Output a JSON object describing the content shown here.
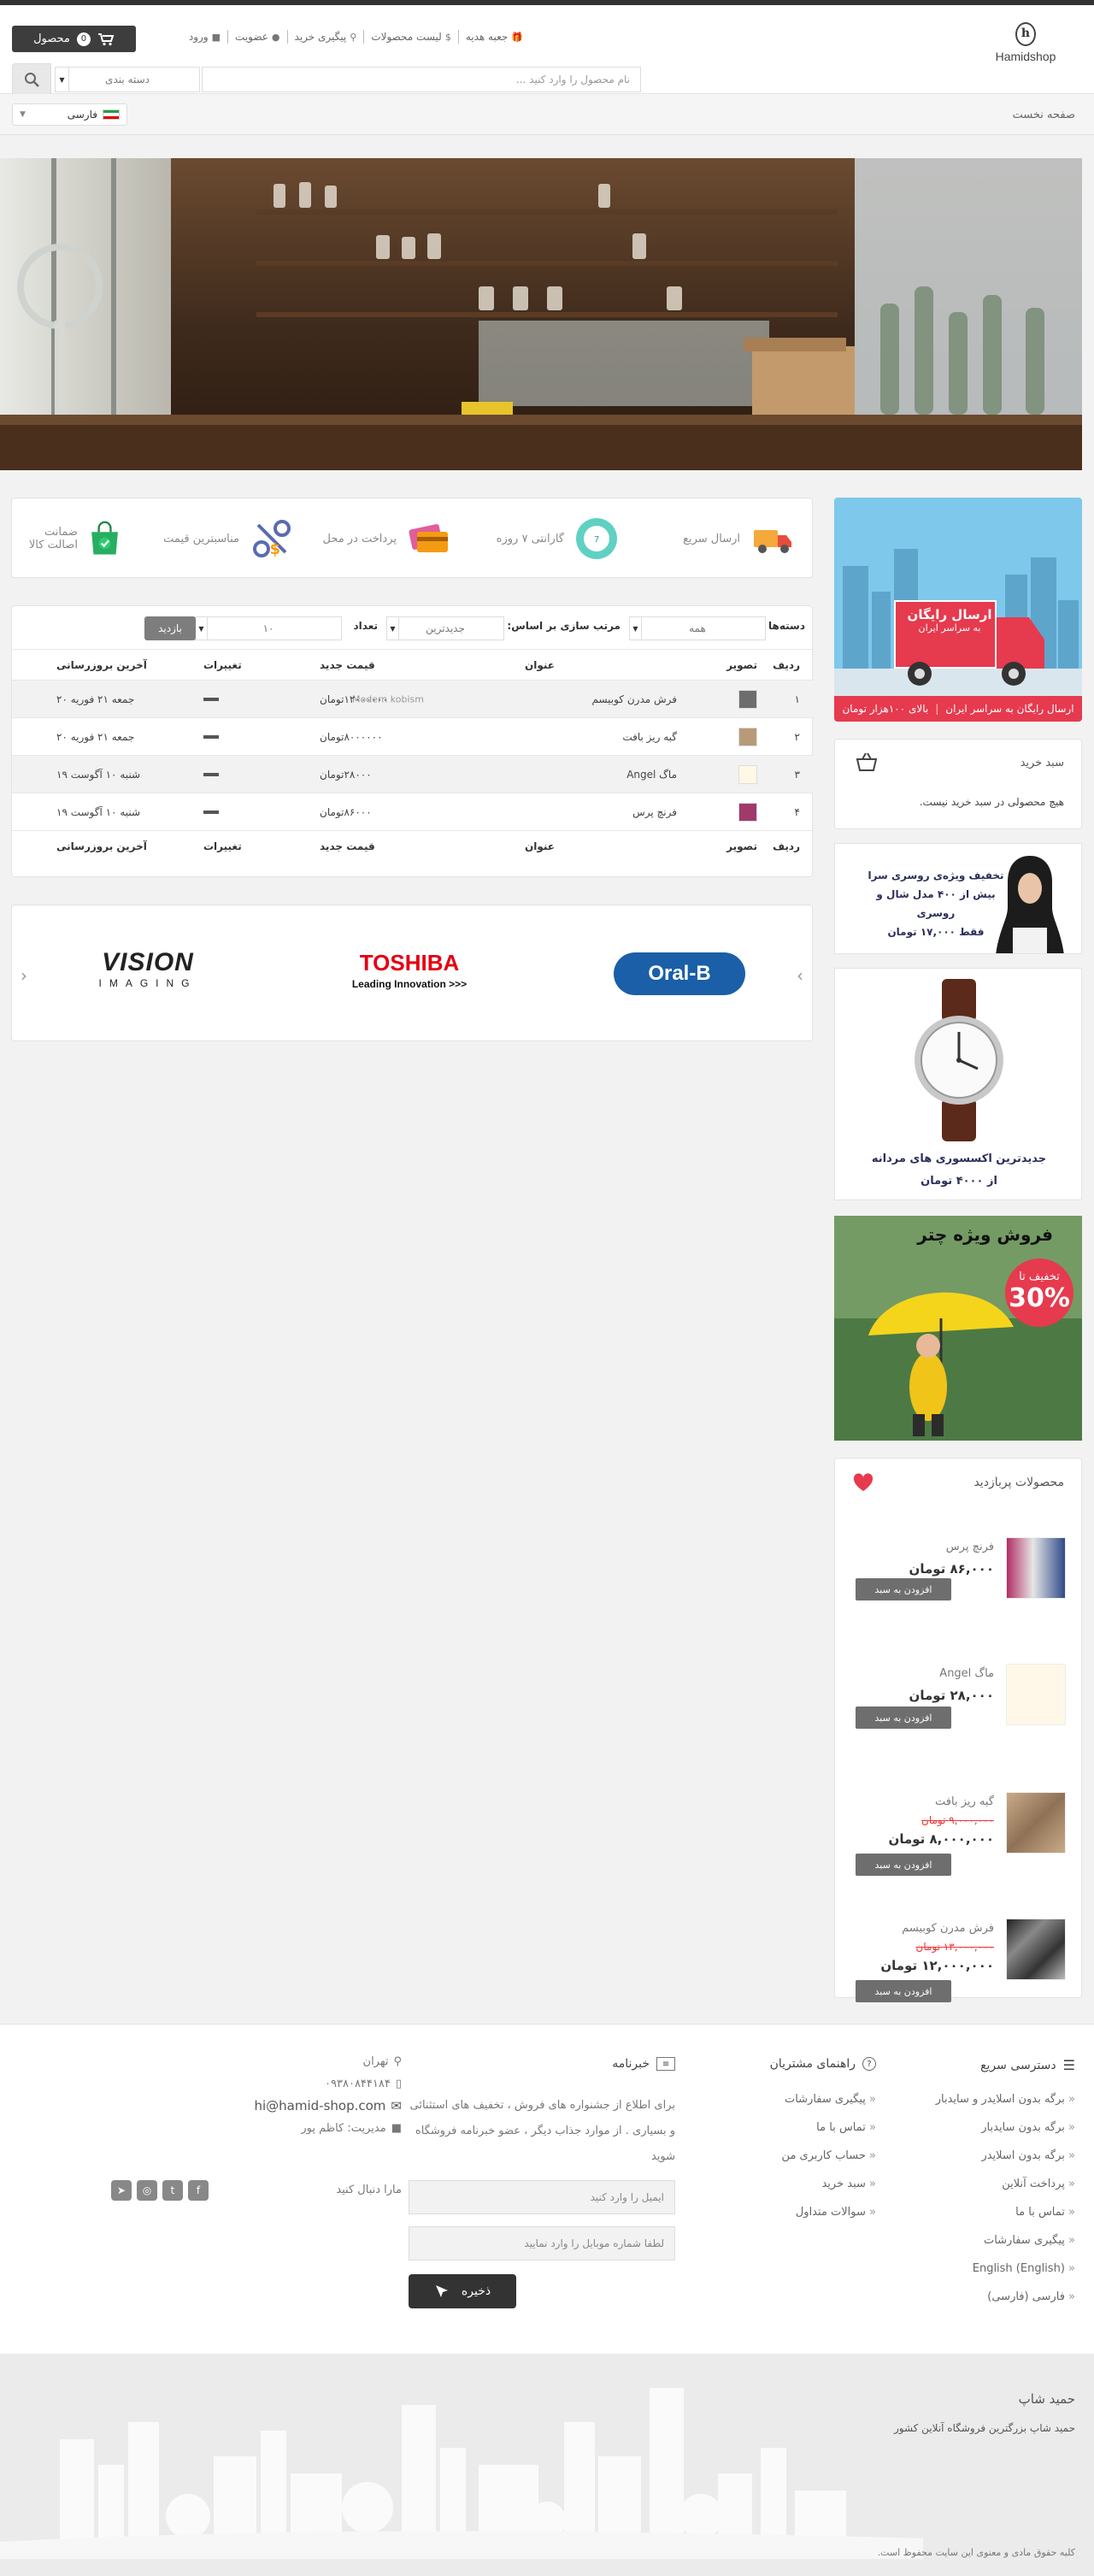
{
  "header": {
    "logo_text": "Hamidshop",
    "logo_mark": "h",
    "links": [
      {
        "label": "جعبه هدیه",
        "icon": "gift-icon",
        "glyph": "🎁"
      },
      {
        "label": "لیست محصولات",
        "icon": "dollar-icon",
        "glyph": "$"
      },
      {
        "label": "پیگیری خرید",
        "icon": "map-marker-icon",
        "glyph": "⚲"
      },
      {
        "label": "عضویت",
        "icon": "user-icon",
        "glyph": "●"
      },
      {
        "label": "ورود",
        "icon": "lock-icon",
        "glyph": "■"
      }
    ],
    "cart_label": "محصول",
    "cart_count": "0",
    "search_placeholder": "نام محصول را وارد کنید ...",
    "category_label": "دسته بندی"
  },
  "breadcrumb": {
    "home": "صفحه نخست"
  },
  "language": {
    "selected": "فارسی"
  },
  "features": [
    {
      "label": "ارسال سریع",
      "icon": "truck-icon"
    },
    {
      "label": "گارانتی ۷ روزه",
      "icon": "guarantee-badge-icon"
    },
    {
      "label": "پرداخت در محل",
      "icon": "credit-card-icon"
    },
    {
      "label": "مناسبترین قیمت",
      "icon": "price-tag-icon"
    },
    {
      "label": "ضمانت اصالت کالا",
      "icon": "shopping-bag-check-icon"
    }
  ],
  "filters": {
    "category_label": "دسته‌ها",
    "category_value": "همه",
    "sort_label": "مرتب سازی بر اساس:",
    "sort_value": "جدیدترین",
    "count_label": "تعداد",
    "count_value": "۱۰",
    "visit_button": "بازدید"
  },
  "table": {
    "columns": [
      "ردیف",
      "تصویر",
      "عنوان",
      "قیمت جدید",
      "تغییرات",
      "آخرین بروزرسانی"
    ],
    "rows": [
      {
        "idx": "۱",
        "title": "فرش مدرن کوبیسم",
        "sub": "Modern kobism",
        "price": "۱۲۰۰۰۰۰۰تومان",
        "date": "جمعه ۲۱ فوریه ۲۰"
      },
      {
        "idx": "۲",
        "title": "گبه ریز بافت",
        "sub": "",
        "price": "۸۰۰۰۰۰۰تومان",
        "date": "جمعه ۲۱ فوریه ۲۰"
      },
      {
        "idx": "۳",
        "title": "ماگ Angel",
        "sub": "",
        "price": "۲۸۰۰۰تومان",
        "date": "شنبه ۱۰ آگوست ۱۹"
      },
      {
        "idx": "۴",
        "title": "فرنچ پرس",
        "sub": "",
        "price": "۸۶۰۰۰تومان",
        "date": "شنبه ۱۰ آگوست ۱۹"
      }
    ]
  },
  "brands": [
    "Oral-B",
    "TOSHIBA",
    "Leading Innovation >>>",
    "VISION",
    "IMAGING"
  ],
  "sidebar": {
    "freeship_title": "ارسال رایگان",
    "freeship_sub": "به سراسر ایران",
    "freeship_bar": [
      "ارسال رایگان به سراسر ایران",
      "بالای ۱۰۰هزار تومان"
    ],
    "cart_title": "سبد خرید",
    "cart_empty": "هیچ محصولی در سبد خرید نیست.",
    "scarf_lines": [
      "تخفیف ویژه‌ی روسری سرا",
      "بیش از ۴۰۰ مدل شال و روسری",
      "فقط ۱۷,۰۰۰ تومان"
    ],
    "watch_lines": [
      "جدیدترین اکسسوری های مردانه",
      "از ۴۰۰۰ تومان"
    ],
    "umbrella_title": "فروش ویژه چتر",
    "umbrella_badge_top": "تخفیف تا",
    "umbrella_badge_pct": "30%",
    "bestsellers_title": "محصولات پربازدید",
    "bestsellers": [
      {
        "name": "فرنچ پرس",
        "old": "",
        "price": "۸۶,۰۰۰ تومان",
        "button": "افزودن به سبد"
      },
      {
        "name": "ماگ Angel",
        "old": "",
        "price": "۲۸,۰۰۰ تومان",
        "button": "افزودن به سبد"
      },
      {
        "name": "گبه ریز بافت",
        "old": "۹,۰۰۰,۰۰۰ تومان",
        "price": "۸,۰۰۰,۰۰۰ تومان",
        "button": "افزودن به سبد"
      },
      {
        "name": "فرش مدرن کوبیسم",
        "old": "۱۳,۰۰۰,۰۰۰ تومان",
        "price": "۱۲,۰۰۰,۰۰۰ تومان",
        "button": "افزودن به سبد"
      }
    ]
  },
  "footer": {
    "quick_title": "دسترسی سریع",
    "quick_links": [
      "برگه بدون اسلایدر و سایدبار",
      "برگه بدون سایدبار",
      "برگه بدون اسلایدر",
      "پرداخت آنلاین",
      "تماس با ما",
      "پیگیری سفارشات",
      "English (English)",
      "فارسی (فارسی)"
    ],
    "help_title": "راهنمای مشتریان",
    "help_links": [
      "پیگیری سفارشات",
      "تماس با ما",
      "حساب کاربری من",
      "سبد خرید",
      "سوالات متداول"
    ],
    "newsletter_title": "خبرنامه",
    "newsletter_text": "برای اطلاع از جشنواره های فروش ، تخفیف های استثنائی و بسیاری . از موارد جذاب دیگر ، عضو خبرنامه فروشگاه شوید",
    "email_placeholder": "ایمیل را وارد کنید",
    "mobile_placeholder": "لطفا شماره موبایل را وارد نمایید",
    "save_button": "ذخیره",
    "city": "تهران",
    "phone": "۰۹۳۸۰۸۴۴۱۸۴",
    "email": "hi@hamid-shop.com",
    "manager": "مدیریت: کاظم پور",
    "follow": "مارا دنبال کنید"
  },
  "bottom": {
    "title": "حمید شاپ",
    "subtitle": "حمید شاپ بزرگترین فروشگاه آنلاین کشور",
    "copyright": "کلیه حقوق مادی و معنوی این سایت محفوظ است."
  },
  "colors": {
    "accent": "#e63a4e",
    "dark": "#333333",
    "navy": "#2c2f5a"
  }
}
